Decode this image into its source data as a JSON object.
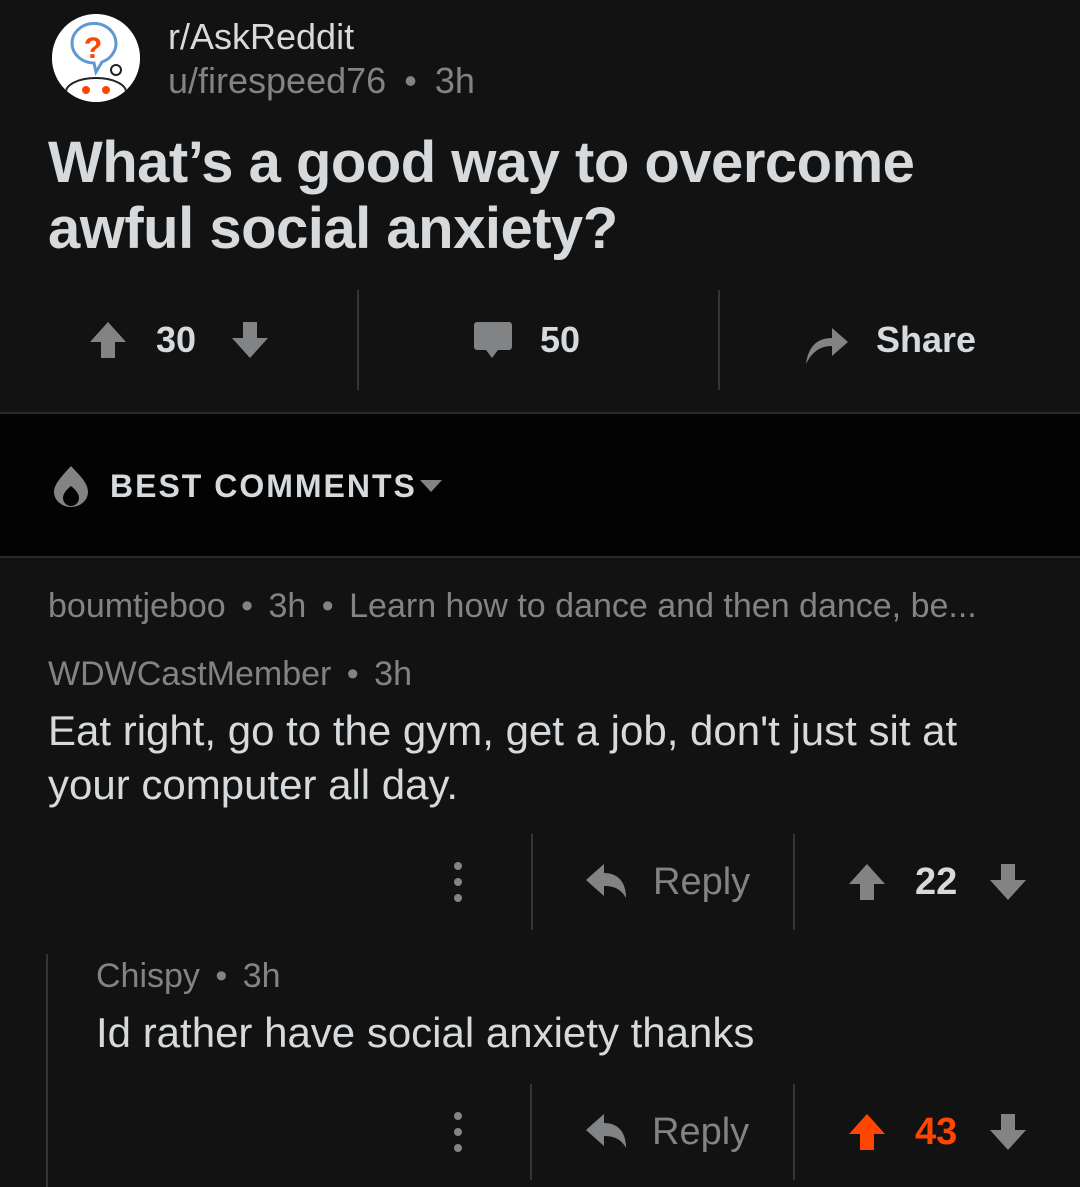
{
  "post": {
    "subreddit": "r/AskReddit",
    "author": "u/firespeed76",
    "time": "3h",
    "title": "What’s a good way to overcome awful social anxiety?",
    "upvotes": "30",
    "comments": "50",
    "share_label": "Share"
  },
  "sort": {
    "label": "BEST COMMENTS"
  },
  "comments": [
    {
      "author": "boumtjeboo",
      "time": "3h",
      "preview": "Learn how to dance and then dance, be..."
    },
    {
      "author": "WDWCastMember",
      "time": "3h",
      "body": "Eat right, go to the gym, get a job, don't just sit at your computer all day.",
      "reply_label": "Reply",
      "score": "22"
    },
    {
      "author": "Chispy",
      "time": "3h",
      "body": "Id rather have social anxiety thanks",
      "reply_label": "Reply",
      "score": "43",
      "upvoted": true
    }
  ],
  "colors": {
    "background": "#121212",
    "text": "#d7dadc",
    "muted": "#818384",
    "upvote_accent": "#ff4500"
  },
  "separator": "•"
}
